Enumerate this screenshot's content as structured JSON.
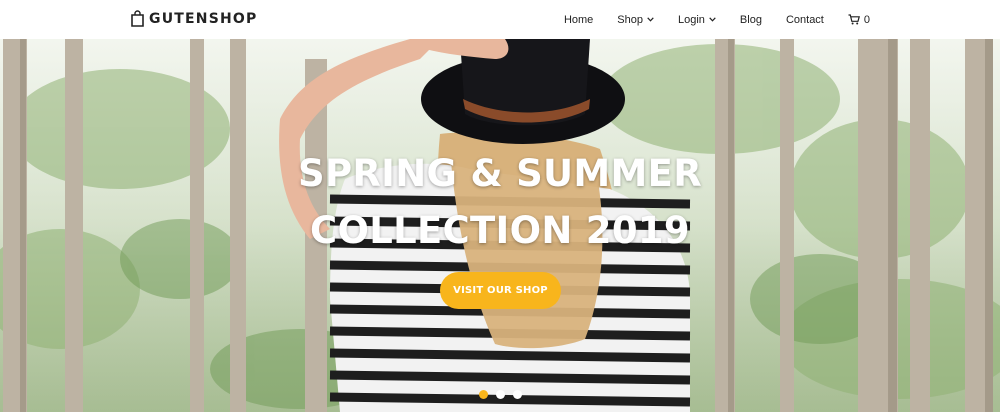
{
  "brand": {
    "name": "GUTENSHOP",
    "icon": "shopping-bag-icon"
  },
  "nav": {
    "items": [
      {
        "label": "Home",
        "has_dropdown": false
      },
      {
        "label": "Shop",
        "has_dropdown": true
      },
      {
        "label": "Login",
        "has_dropdown": true
      },
      {
        "label": "Blog",
        "has_dropdown": false
      },
      {
        "label": "Contact",
        "has_dropdown": false
      }
    ],
    "cart": {
      "icon": "cart-icon",
      "count": "0"
    }
  },
  "hero": {
    "title_line1": "SPRING & SUMMER",
    "title_line2": "COLLECTION 2019",
    "button_label": "VISIT OUR SHOP",
    "slides": {
      "total": 3,
      "active": 1
    }
  },
  "colors": {
    "accent": "#f8b51c",
    "text_dark": "#222222",
    "hero_text": "#ffffff"
  }
}
